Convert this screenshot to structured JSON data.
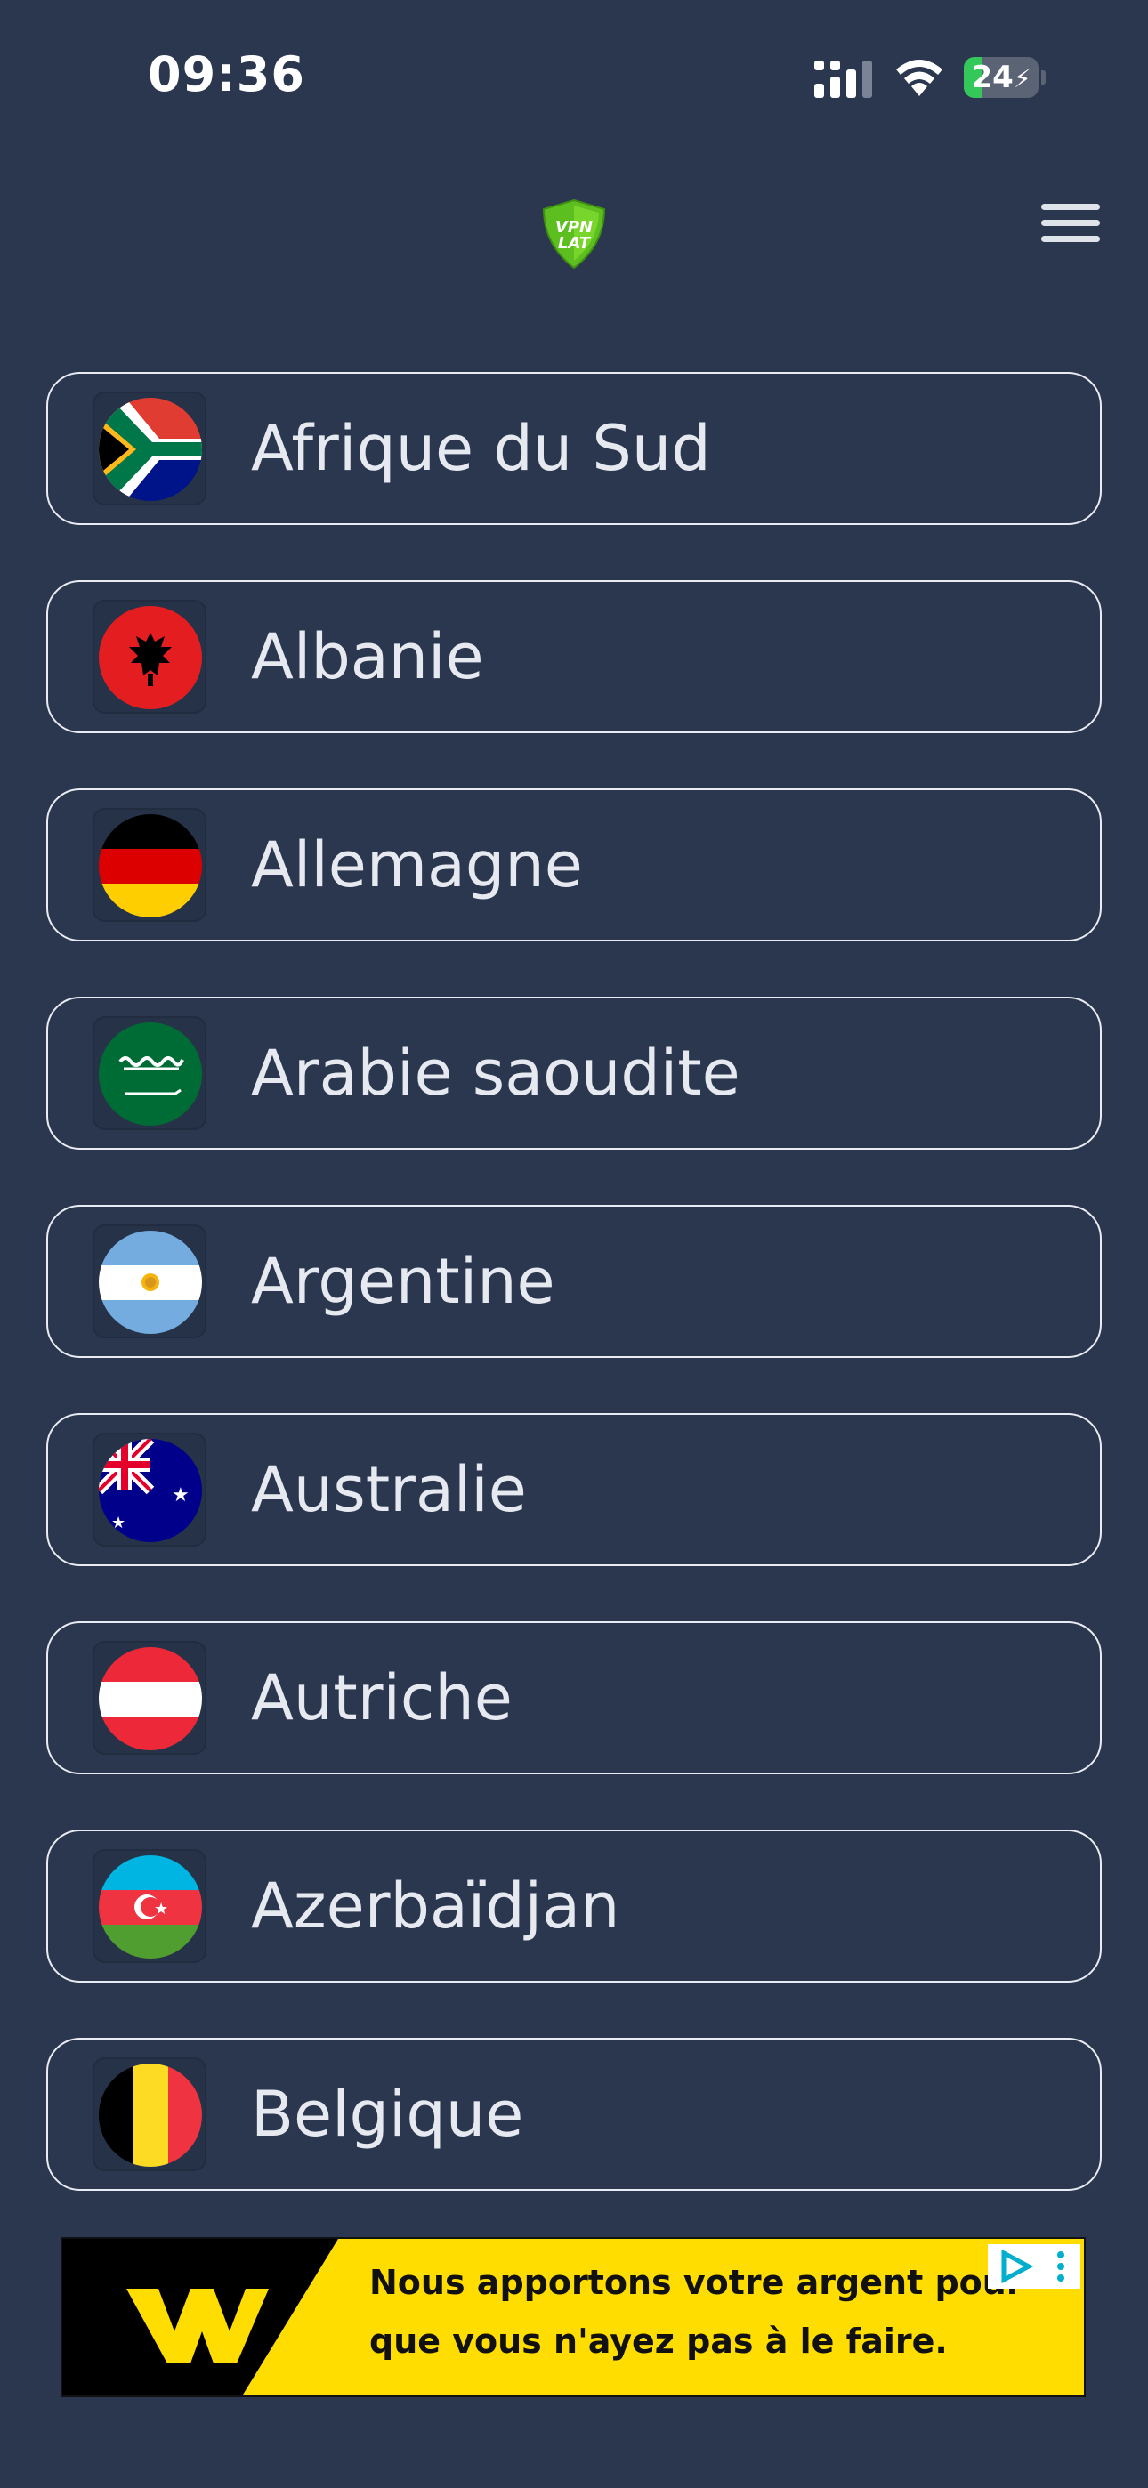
{
  "status_bar": {
    "time": "09:36",
    "battery_level": "24",
    "battery_fraction": 0.24,
    "icons": [
      "cellular-signal-icon",
      "wifi-icon",
      "battery-charging-icon"
    ]
  },
  "header": {
    "logo_text_line1": "VPN",
    "logo_text_line2": "LAT",
    "menu_icon": "hamburger-menu-icon"
  },
  "countries": [
    {
      "name": "Afrique du Sud",
      "flag": "flag-south-africa-icon"
    },
    {
      "name": "Albanie",
      "flag": "flag-albania-icon"
    },
    {
      "name": "Allemagne",
      "flag": "flag-germany-icon"
    },
    {
      "name": "Arabie saoudite",
      "flag": "flag-saudi-arabia-icon"
    },
    {
      "name": "Argentine",
      "flag": "flag-argentina-icon"
    },
    {
      "name": "Australie",
      "flag": "flag-australia-icon"
    },
    {
      "name": "Autriche",
      "flag": "flag-austria-icon"
    },
    {
      "name": "Azerbaïdjan",
      "flag": "flag-azerbaijan-icon"
    },
    {
      "name": "Belgique",
      "flag": "flag-belgium-icon"
    }
  ],
  "ad": {
    "line1": "Nous apportons votre argent pour",
    "line2": "que vous n'ayez pas à le faire.",
    "brand_icon": "western-union-logo",
    "choices_icon": "ad-choices-icon"
  },
  "colors": {
    "background": "#2a374f",
    "border": "#e9ecf2",
    "ad_yellow": "#ffdd00",
    "battery_green": "#34c759"
  }
}
